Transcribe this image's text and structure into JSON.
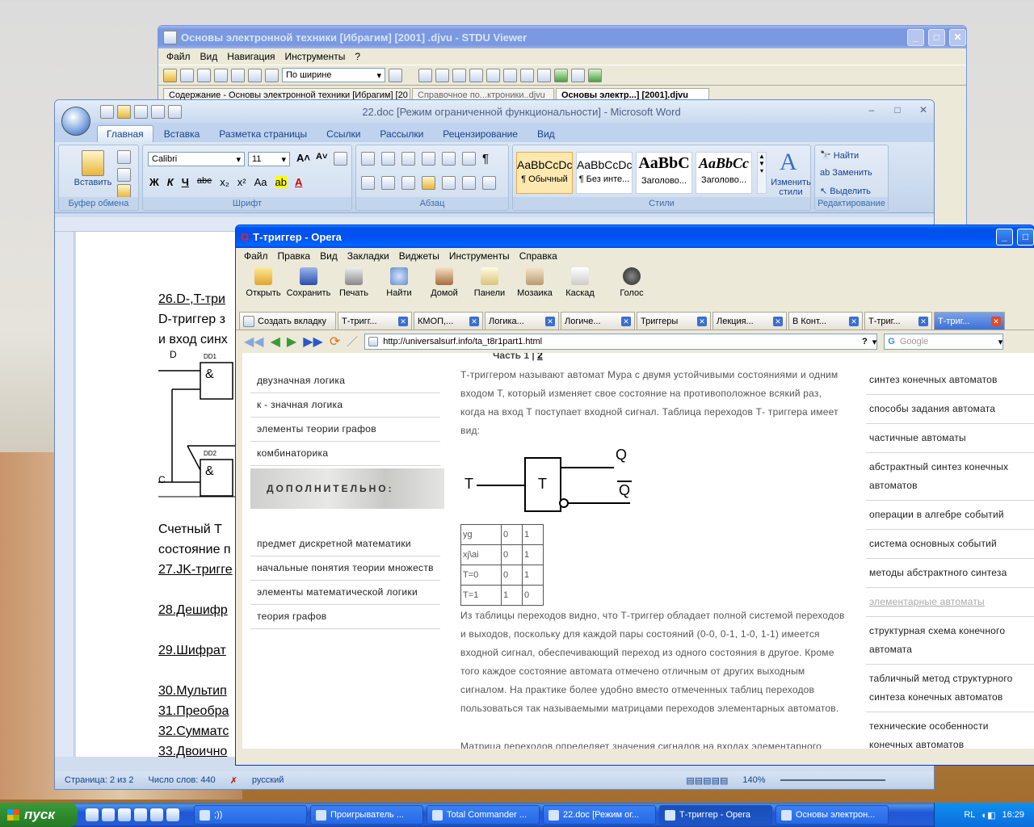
{
  "stdu": {
    "title": "Основы электронной техники [Ибрагим] [2001] .djvu - STDU Viewer",
    "menu": [
      "Файл",
      "Вид",
      "Навигация",
      "Инструменты",
      "?"
    ],
    "zoom": "По ширине",
    "sidebar_tab": "Содержание - Основы электронной техники [Ибрагим] [20",
    "tabs": [
      "Справочное по...ктроники..djvu",
      "Основы электр...] [2001].djvu"
    ]
  },
  "word": {
    "title": "22.doc [Режим ограниченной функциональности] - Microsoft Word",
    "tabs": [
      "Главная",
      "Вставка",
      "Разметка страницы",
      "Ссылки",
      "Рассылки",
      "Рецензирование",
      "Вид"
    ],
    "font": "Calibri",
    "size": "11",
    "groups": {
      "clipboard": "Буфер обмена",
      "font": "Шрифт",
      "paragraph": "Абзац",
      "styles": "Стили",
      "editing": "Редактирование"
    },
    "paste": "Вставить",
    "styles": [
      {
        "sample": "AaBbCcDc",
        "name": "¶ Обычный"
      },
      {
        "sample": "AaBbCcDc",
        "name": "¶ Без инте..."
      },
      {
        "sample": "AaBbC",
        "name": "Заголово..."
      },
      {
        "sample": "AaBbCc",
        "name": "Заголово..."
      }
    ],
    "change_styles": "Изменить стили",
    "find": "Найти",
    "replace": "Заменить",
    "select": "Выделить",
    "doc": {
      "l1": "26.D-,T-три",
      "l2": "D-триггер з",
      "l3": "и вход синх",
      "l4": "Счетный  Т",
      "l5": "состояние п",
      "l6": "27.JK-тригге",
      "l7": "28.Дешифр",
      "l8": "29.Шифрат",
      "l9": "30.Мультип",
      "l10": "31.Преобра",
      "l11": "32.Сумматс",
      "l12": "33.Двоично",
      "d": "D",
      "c": "C",
      "dd1": "DD1",
      "dd2": "DD2",
      "amp": "&"
    },
    "status": {
      "page": "Страница: 2 из 2",
      "words": "Число слов: 440",
      "lang": "русский",
      "zoom": "140%"
    }
  },
  "opera": {
    "title": "Т-триггер - Opera",
    "menu": [
      "Файл",
      "Правка",
      "Вид",
      "Закладки",
      "Виджеты",
      "Инструменты",
      "Справка"
    ],
    "toolbar": [
      "Открыть",
      "Сохранить",
      "Печать",
      "Найти",
      "Домой",
      "Панели",
      "Мозаика",
      "Каскад",
      "Голос"
    ],
    "newtab": "Создать вкладку",
    "tabs": [
      "Т-тригг...",
      "КМОП,...",
      "Логика...",
      "Логиче...",
      "Триггеры",
      "Лекция...",
      "В Конт...",
      "Т-триг...",
      "Т-триг..."
    ],
    "url": "http://universalsurf.info/ta_t8r1part1.html",
    "search_placeholder": "Google",
    "part_label": "Часть 1",
    "part_sep": "|",
    "part2": "2",
    "left_nav_top": [
      "двузначная логика",
      "к - значная логика",
      "элементы теории графов",
      "комбинаторика"
    ],
    "extra_header": "ДОПОЛНИТЕЛЬНО:",
    "left_nav_bottom": [
      "предмет дискретной математики",
      "начальные понятия теории множеств",
      "элементы математической логики",
      "теория графов"
    ],
    "intro": "Т-триггером называют автомат Мура с двумя устойчивыми состояниями и одним входом Т, который изменяет свое состояние на противоположное всякий раз, когда на вход Т  поступает входной сигнал. Таблица переходов Т- триггера имеет вид:",
    "diagram": {
      "t_in": "T",
      "t_box": "T",
      "q": "Q",
      "qbar": "Q"
    },
    "table": [
      [
        "yg",
        "0",
        "1"
      ],
      [
        "xj\\ai",
        "0",
        "1"
      ],
      [
        "T=0",
        "0",
        "1"
      ],
      [
        "T=1",
        "1",
        "0"
      ]
    ],
    "body": "Из таблицы переходов видно, что Т-триггер обладает полной системой переходов и выходов, поскольку для каждой пары состояний (0-0, 0-1, 1-0, 1-1) имеется входной сигнал, обеспечивающий переход из одного состояния в другое. Кроме того каждое состояние автомата отмечено отличным от других выходным сигналом. На практике более удобно вместо отмеченных таблиц переходов пользоваться так называемыми матрицами переходов элементарных автоматов.",
    "body2": "Матрица переходов определяет значения сигналов на входах элементарного",
    "right_nav": [
      "синтез конечных автоматов",
      "способы задания автомата",
      "частичные автоматы",
      "абстрактный синтез конечных автоматов",
      "операции в алгебре событий",
      "система основных событий",
      "методы абстрактного синтеза",
      "элементарные автоматы",
      "структурная схема конечного автомата",
      "табличный метод структурного синтеза конечных автоматов",
      "технические особенности конечных автоматов"
    ]
  },
  "taskbar": {
    "start": "пуск",
    "tasks": [
      ";))",
      "Проигрыватель ...",
      "Total Commander ...",
      "22.doc [Режим ог...",
      "Т-триггер - Opera",
      "Основы электрон..."
    ],
    "lang": "RL",
    "clock": "16:29"
  }
}
